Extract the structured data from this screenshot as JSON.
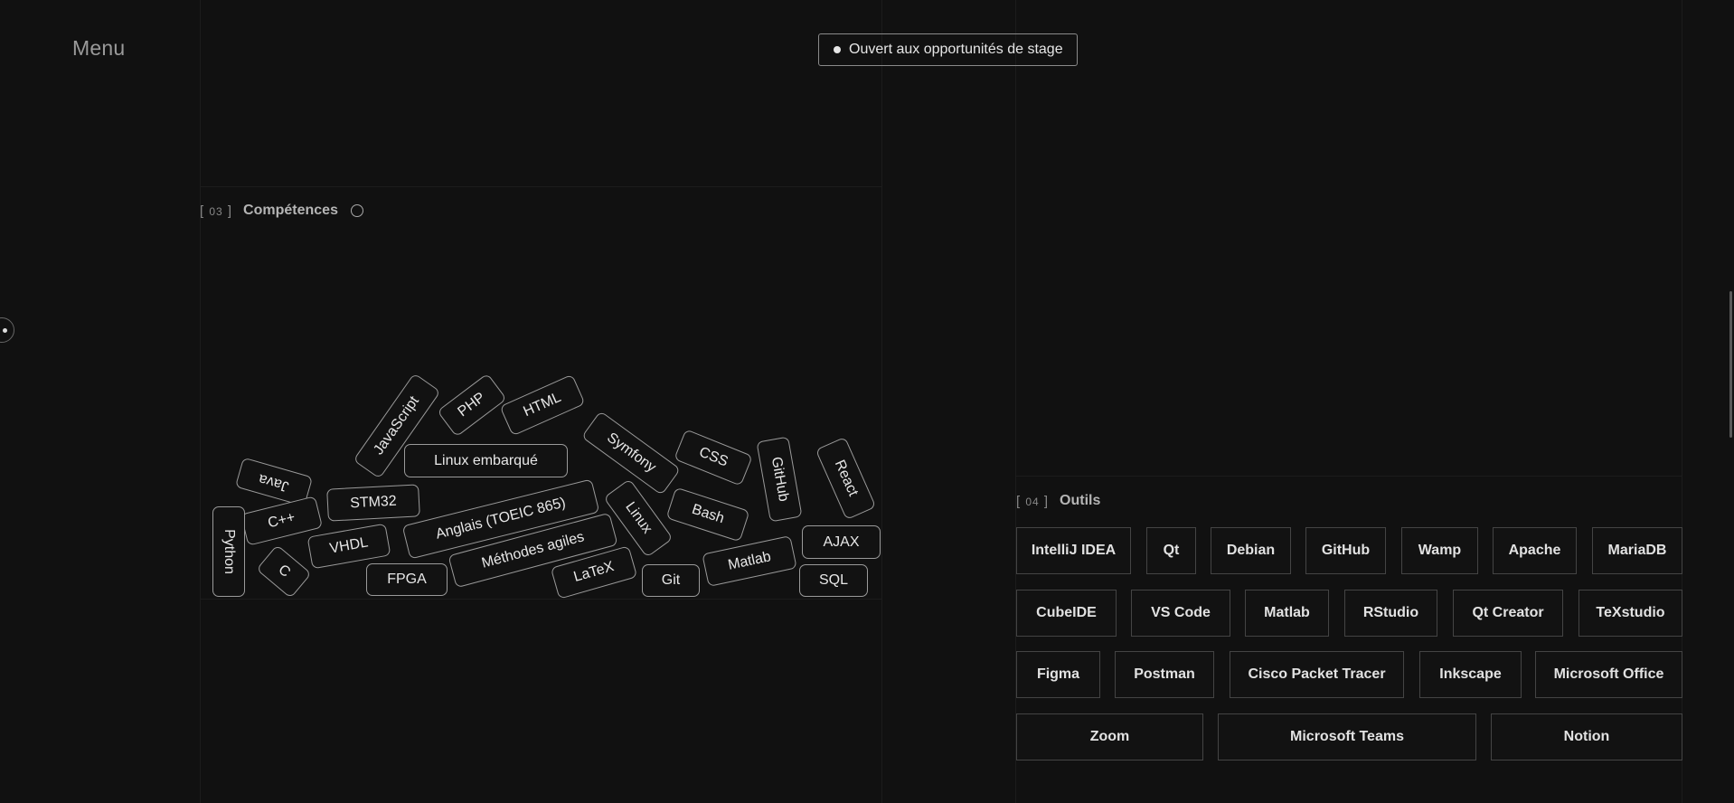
{
  "nav": {
    "menu_label": "Menu"
  },
  "status": {
    "label": "Ouvert aux opportunités de stage"
  },
  "skills": {
    "number": "03",
    "title": "Compétences",
    "pills": [
      {
        "label": "JavaScript"
      },
      {
        "label": "PHP"
      },
      {
        "label": "HTML"
      },
      {
        "label": "Linux embarqué"
      },
      {
        "label": "Symfony"
      },
      {
        "label": "CSS"
      },
      {
        "label": "GitHub"
      },
      {
        "label": "React"
      },
      {
        "label": "Java"
      },
      {
        "label": "STM32"
      },
      {
        "label": "C++"
      },
      {
        "label": "Anglais (TOEIC 865)"
      },
      {
        "label": "Linux"
      },
      {
        "label": "Bash"
      },
      {
        "label": "Python"
      },
      {
        "label": "VHDL"
      },
      {
        "label": "Méthodes agiles"
      },
      {
        "label": "AJAX"
      },
      {
        "label": "C"
      },
      {
        "label": "FPGA"
      },
      {
        "label": "LaTeX"
      },
      {
        "label": "Git"
      },
      {
        "label": "Matlab"
      },
      {
        "label": "SQL"
      }
    ]
  },
  "tools": {
    "number": "04",
    "title": "Outils",
    "items": [
      {
        "label": "IntelliJ IDEA"
      },
      {
        "label": "Qt"
      },
      {
        "label": "Debian"
      },
      {
        "label": "GitHub"
      },
      {
        "label": "Wamp"
      },
      {
        "label": "Apache"
      },
      {
        "label": "MariaDB"
      },
      {
        "label": "CubeIDE"
      },
      {
        "label": "VS Code"
      },
      {
        "label": "Matlab"
      },
      {
        "label": "RStudio"
      },
      {
        "label": "Qt Creator"
      },
      {
        "label": "TeXstudio"
      },
      {
        "label": "Figma"
      },
      {
        "label": "Postman"
      },
      {
        "label": "Cisco Packet Tracer"
      },
      {
        "label": "Inkscape"
      },
      {
        "label": "Microsoft Office"
      },
      {
        "label": "Zoom"
      },
      {
        "label": "Microsoft Teams"
      },
      {
        "label": "Notion"
      }
    ]
  },
  "colors": {
    "background": "#111111",
    "border": "#9a9a9a",
    "text": "#e8e8e8"
  }
}
